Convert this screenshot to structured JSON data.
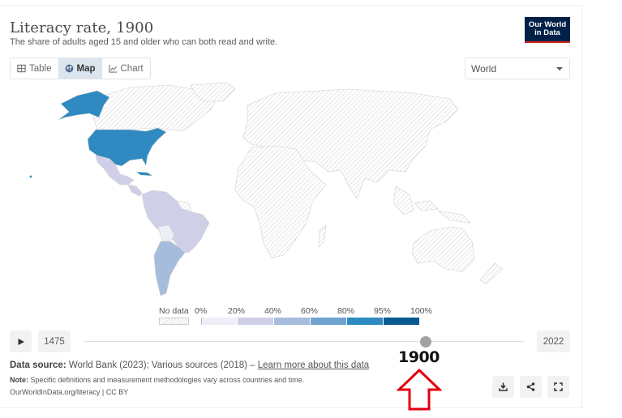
{
  "header": {
    "title": "Literacy rate, 1900",
    "subtitle": "The share of adults aged 15 and older who can both read and write.",
    "logo_line1": "Our World",
    "logo_line2": "in Data"
  },
  "tabs": [
    {
      "label": "Table",
      "icon": "table-icon",
      "active": false
    },
    {
      "label": "Map",
      "icon": "globe-icon",
      "active": true
    },
    {
      "label": "Chart",
      "icon": "line-chart-icon",
      "active": false
    }
  ],
  "region_selector": {
    "value": "World"
  },
  "colors": {
    "no_data_hatch": "#dddddd",
    "bins": [
      "#eeeef7",
      "#cfd0e8",
      "#a6bcdd",
      "#6fa3cf",
      "#2e8ac0",
      "#0a5a91"
    ],
    "brand_navy": "#002147",
    "brand_red": "#ce261e",
    "callout_red": "#e3000f"
  },
  "legend": {
    "no_data_label": "No data",
    "tick_labels": [
      "0%",
      "20%",
      "40%",
      "60%",
      "80%",
      "95%",
      "100%"
    ]
  },
  "map": {
    "highlighted_regions": [
      {
        "region": "United States (incl. Alaska)",
        "bin": "80%–95%"
      },
      {
        "region": "Mexico",
        "bin": "20%–40%"
      },
      {
        "region": "Central America",
        "bin": "20%–40%"
      },
      {
        "region": "Colombia/Venezuela/Ecuador/Peru",
        "bin": "20%–40%"
      },
      {
        "region": "Brazil",
        "bin": "20%–40%"
      },
      {
        "region": "Paraguay",
        "bin": "20%–40%"
      },
      {
        "region": "Bolivia",
        "bin": "0%–20%"
      },
      {
        "region": "Argentina / Chile / Uruguay",
        "bin": "40%–60%"
      },
      {
        "region": "Rest of world",
        "bin": "No data"
      }
    ]
  },
  "timeline": {
    "start_year": "1475",
    "end_year": "2022",
    "selected_year": "1900",
    "selected_fraction": 0.777
  },
  "footer": {
    "source_label": "Data source:",
    "source_text": " World Bank (2023); Various sources (2018) – ",
    "source_link": "Learn more about this data",
    "note_label": "Note:",
    "note_text": " Specific definitions and measurement methodologies vary across countries and time.",
    "url": "OurWorldInData.org/literacy | CC BY"
  },
  "annotation": {
    "callout_year": "1900"
  }
}
